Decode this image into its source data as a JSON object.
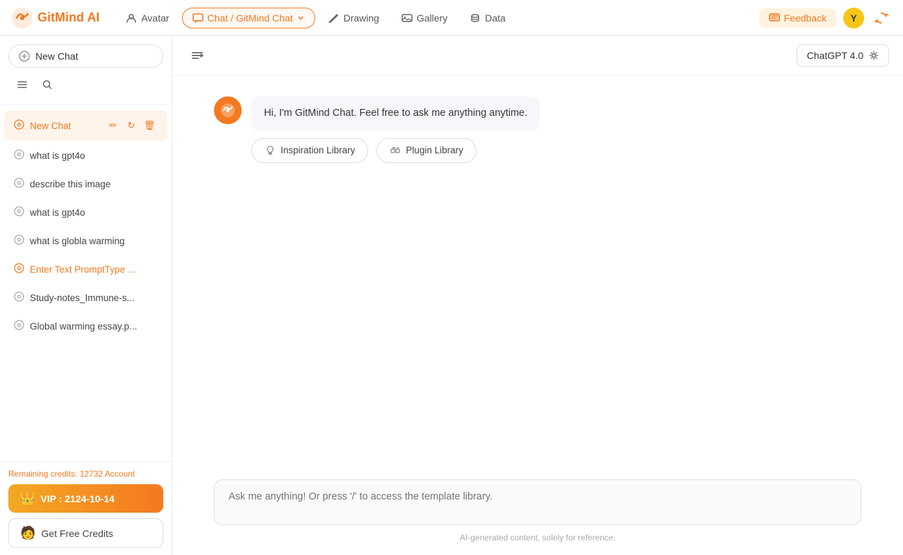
{
  "app": {
    "name": "GitMind AI"
  },
  "topnav": {
    "logo_text": "GitMind AI",
    "items": [
      {
        "id": "avatar",
        "label": "Avatar",
        "active": false
      },
      {
        "id": "chat",
        "label": "Chat / GitMind Chat",
        "active": true
      },
      {
        "id": "drawing",
        "label": "Drawing",
        "active": false
      },
      {
        "id": "gallery",
        "label": "Gallery",
        "active": false
      },
      {
        "id": "data",
        "label": "Data",
        "active": false
      }
    ],
    "feedback_label": "Feedback",
    "avatar_letter": "Y"
  },
  "sidebar": {
    "new_chat_label": "New Chat",
    "active_chat_label": "New Chat",
    "chats": [
      {
        "id": "c1",
        "label": "what is gpt4o",
        "active": false
      },
      {
        "id": "c2",
        "label": "describe this image",
        "active": false
      },
      {
        "id": "c3",
        "label": "what is gpt4o",
        "active": false
      },
      {
        "id": "c4",
        "label": "what is globla warming",
        "active": false
      },
      {
        "id": "c5",
        "label": "Enter Text PromptType ...",
        "active": false,
        "highlight": true
      },
      {
        "id": "c6",
        "label": "Study-notes_Immune-s...",
        "active": false
      },
      {
        "id": "c7",
        "label": "Global warming essay.p...",
        "active": false
      }
    ],
    "credits_prefix": "Remaining credits: ",
    "credits_value": "12732",
    "credits_link": "Account",
    "vip_label": "VIP : 2124-10-14",
    "free_credits_label": "Get Free Credits"
  },
  "chat": {
    "collapse_icon": "≡",
    "model_label": "ChatGPT 4.0",
    "welcome_message": "Hi, I'm GitMind Chat. Feel free to ask me anything anytime.",
    "suggestion_buttons": [
      {
        "id": "inspiration",
        "label": "Inspiration Library"
      },
      {
        "id": "plugin",
        "label": "Plugin Library"
      }
    ],
    "input_placeholder": "Ask me anything! Or press '/' to access the template library.",
    "footer_note": "AI-generated content, solely for reference."
  }
}
